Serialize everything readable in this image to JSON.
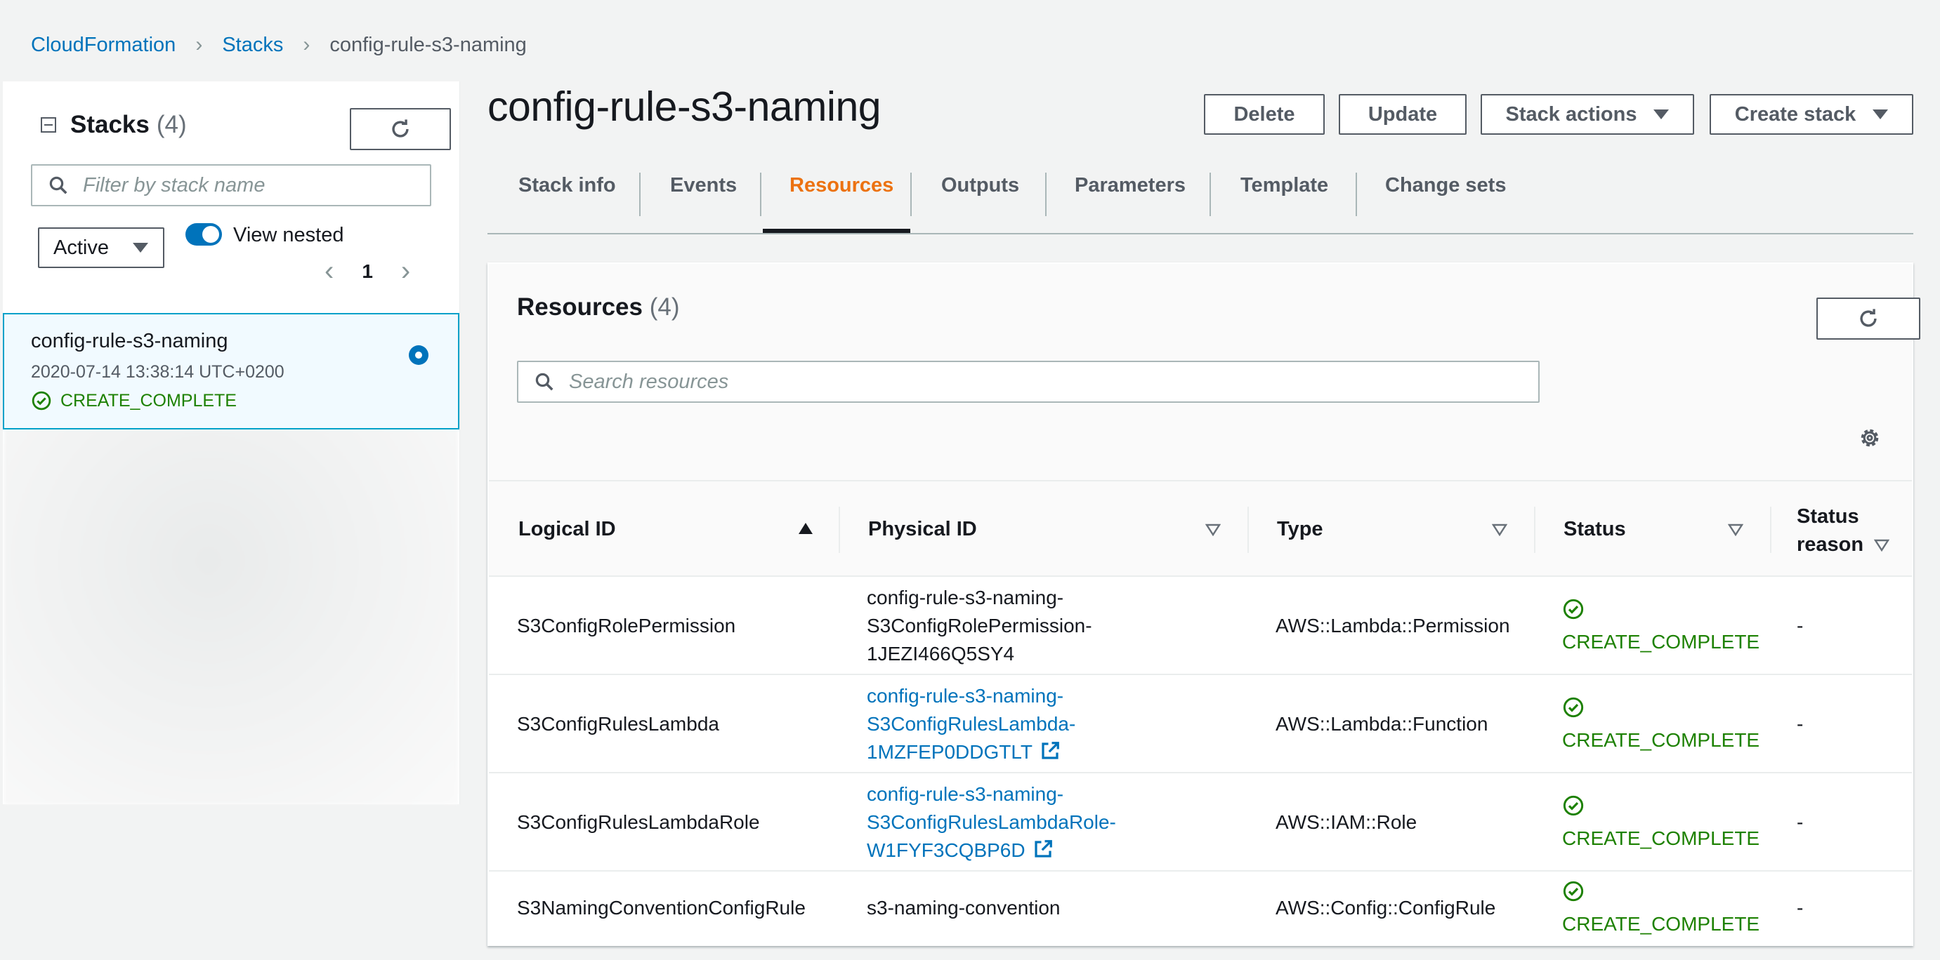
{
  "breadcrumb": {
    "item1": "CloudFormation",
    "item2": "Stacks",
    "current": "config-rule-s3-naming"
  },
  "sidebar": {
    "title": "Stacks",
    "count": "(4)",
    "filter_placeholder": "Filter by stack name",
    "status_filter": "Active",
    "view_nested_label": "View nested",
    "view_nested_on": true,
    "page": "1",
    "stack": {
      "name": "config-rule-s3-naming",
      "created": "2020-07-14 13:38:14 UTC+0200",
      "status": "CREATE_COMPLETE"
    }
  },
  "header": {
    "title": "config-rule-s3-naming",
    "delete_label": "Delete",
    "update_label": "Update",
    "stack_actions_label": "Stack actions",
    "create_stack_label": "Create stack"
  },
  "tabs": [
    {
      "label": "Stack info"
    },
    {
      "label": "Events"
    },
    {
      "label": "Resources",
      "active": true
    },
    {
      "label": "Outputs"
    },
    {
      "label": "Parameters"
    },
    {
      "label": "Template"
    },
    {
      "label": "Change sets"
    }
  ],
  "resources": {
    "title": "Resources",
    "count": "(4)",
    "search_placeholder": "Search resources",
    "columns": {
      "logical_id": "Logical ID",
      "physical_id": "Physical ID",
      "type": "Type",
      "status": "Status",
      "status_reason_1": "Status",
      "status_reason_2": "reason"
    },
    "rows": [
      {
        "logical_id": "S3ConfigRolePermission",
        "physical_1": "config-rule-s3-naming-",
        "physical_2": "S3ConfigRolePermission-",
        "physical_3": "1JEZI466Q5SY4",
        "type": "AWS::Lambda::Permission",
        "status": "CREATE_COMPLETE",
        "reason": "-"
      },
      {
        "logical_id": "S3ConfigRulesLambda",
        "physical_1": "config-rule-s3-naming-",
        "physical_2": "S3ConfigRulesLambda-",
        "physical_3": "1MZFEP0DDGTLT",
        "type": "AWS::Lambda::Function",
        "status": "CREATE_COMPLETE",
        "reason": "-"
      },
      {
        "logical_id": "S3ConfigRulesLambdaRole",
        "physical_1": "config-rule-s3-naming-",
        "physical_2": "S3ConfigRulesLambdaRole-",
        "physical_3": "W1FYF3CQBP6D",
        "type": "AWS::IAM::Role",
        "status": "CREATE_COMPLETE",
        "reason": "-"
      },
      {
        "logical_id": "S3NamingConventionConfigRule",
        "physical_1": "s3-naming-convention",
        "type": "AWS::Config::ConfigRule",
        "status": "CREATE_COMPLETE",
        "reason": "-"
      }
    ]
  },
  "colors": {
    "link": "#0073bb",
    "accent": "#ec7211",
    "success": "#1d8102",
    "selected_border": "#00a1c9"
  },
  "icons": [
    "refresh-icon",
    "search-icon",
    "gear-icon",
    "check-circle-icon",
    "external-link-icon",
    "collapse-icon",
    "caret-down-icon",
    "sort-ascending-icon",
    "sort-icon"
  ]
}
